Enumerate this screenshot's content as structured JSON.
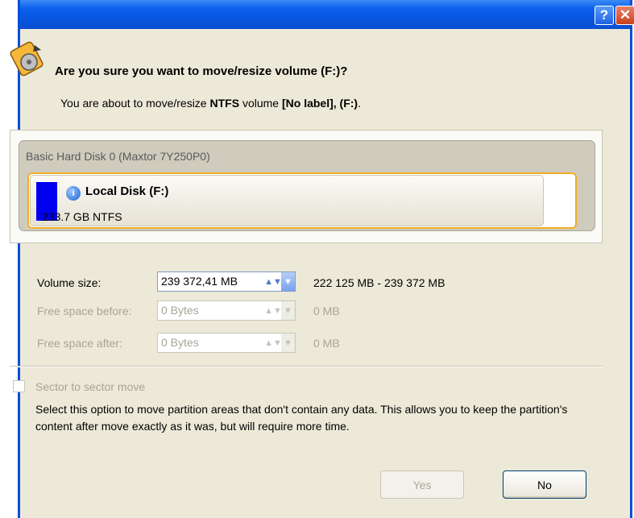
{
  "titlebar": {
    "help_label": "?",
    "close_label": "✕"
  },
  "header": {
    "question": "Are you sure you want to move/resize volume (F:)?",
    "sub_prefix": "You are about to move/resize ",
    "sub_fs": "NTFS",
    "sub_mid": " volume ",
    "sub_label": "[No label], (F:)",
    "sub_end": "."
  },
  "disk": {
    "title": "Basic Hard Disk 0 (Maxtor 7Y250P0)",
    "volume_name": "Local Disk (F:)",
    "volume_size": "233.7 GB NTFS",
    "bar_color": "#0000f0"
  },
  "fields": [
    {
      "label": "Volume size:",
      "value": "239 372,41 MB",
      "range": "222 125 MB - 239 372 MB",
      "enabled": true
    },
    {
      "label": "Free space before:",
      "value": "0 Bytes",
      "range": "0 MB",
      "enabled": false
    },
    {
      "label": "Free space after:",
      "value": "0 Bytes",
      "range": "0 MB",
      "enabled": false
    }
  ],
  "sector_move": {
    "label": "Sector to sector move",
    "checked": false,
    "description": "Select this option to move partition areas that don't contain any data. This allows you to keep the partition's content after move exactly as it was, but will require more time."
  },
  "buttons": {
    "yes": "Yes",
    "no": "No"
  },
  "icons": {
    "dialog": "disk-resize-icon",
    "volume": "info-icon",
    "spin": "spin-icon",
    "dropdown": "chevron-down-icon"
  },
  "colors": {
    "title_bar": "#0a60ee",
    "dialog_bg": "#ece9d8",
    "highlight": "#f2ad27"
  }
}
